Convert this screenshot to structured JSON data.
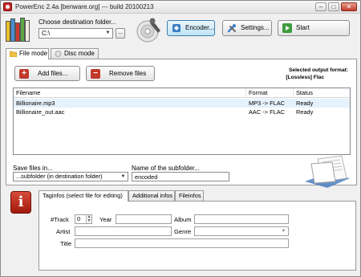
{
  "window": {
    "title": "PowerEnc 2.4a [benware.org] --- build 20100213",
    "min_glyph": "–",
    "max_glyph": "□",
    "close_glyph": "✕"
  },
  "toolbar": {
    "destination_label": "Choose destination folder...",
    "destination_value": "C:\\",
    "browse_label": "...",
    "encoder_label": "Encoder...",
    "settings_label": "Settings...",
    "start_label": "Start"
  },
  "tabs": [
    {
      "label": "File mode",
      "selected": true
    },
    {
      "label": "Disc mode",
      "selected": false
    }
  ],
  "file_mode": {
    "add_label": "Add files...",
    "remove_label": "Remove files",
    "output_format_label": "Selected output format:",
    "output_format_value": "[Lossless] Flac"
  },
  "file_list": {
    "columns": [
      "Filename",
      "Format",
      "Status"
    ],
    "rows": [
      {
        "filename": "Billionaire.mp3",
        "format": "MP3 -> FLAC",
        "status": "Ready"
      },
      {
        "filename": "Billionaire_out.aac",
        "format": "AAC -> FLAC",
        "status": "Ready"
      }
    ]
  },
  "save": {
    "label": "Save files in...",
    "value": "...subfolder (in destination folder)"
  },
  "subfolder": {
    "label": "Name of the subfolder...",
    "value": "encoded"
  },
  "tag_tabs": [
    {
      "label": "Taginfos (select file for editing)",
      "selected": true
    },
    {
      "label": "Additional infos",
      "selected": false
    },
    {
      "label": "Fileinfos",
      "selected": false
    }
  ],
  "tag_fields": {
    "track_label": "#Track",
    "track_value": "0",
    "year_label": "Year",
    "album_label": "Album",
    "artist_label": "Artist",
    "genre_label": "Genre",
    "title_label": "Title"
  },
  "colors": {
    "window_bg": "#f0f0f0",
    "selection_bg": "#e5f1fb",
    "accent_red": "#c0392b",
    "active_button_blue": "#bfe3f7"
  }
}
